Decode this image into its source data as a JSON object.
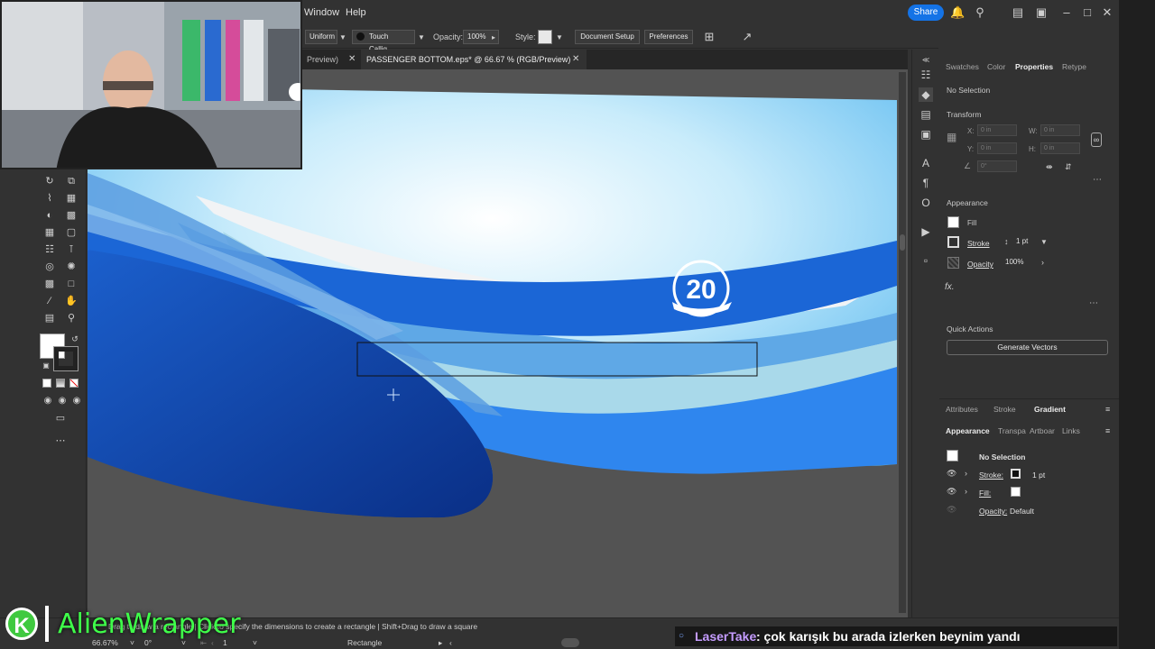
{
  "menu": {
    "window": "Window",
    "help": "Help",
    "share": "Share"
  },
  "control_bar": {
    "profile": "Uniform",
    "brush": "Touch Callig...",
    "opacity_label": "Opacity:",
    "opacity_value": "100%",
    "style_label": "Style:",
    "document_setup": "Document Setup",
    "preferences": "Preferences"
  },
  "tabs": [
    {
      "label": "Preview)"
    },
    {
      "label": "PASSENGER BOTTOM.eps* @ 66.67 % (RGB/Preview)"
    }
  ],
  "artwork": {
    "badge_number": "20"
  },
  "properties": {
    "tabs": [
      "Swatches",
      "Color",
      "Properties",
      "Retype"
    ],
    "active_tab": "Properties",
    "selection": "No Selection",
    "transform_title": "Transform",
    "x_label": "X:",
    "y_label": "Y:",
    "w_label": "W:",
    "h_label": "H:",
    "x_value": "0 in",
    "y_value": "0 in",
    "w_value": "0 in",
    "h_value": "0 in",
    "angle_value": "0°",
    "appearance_title": "Appearance",
    "fill_label": "Fill",
    "stroke_label": "Stroke",
    "stroke_weight": "1 pt",
    "opacity_label": "Opacity",
    "opacity_value": "100%",
    "fx_label": "fx.",
    "quick_actions_title": "Quick Actions",
    "generate_vectors": "Generate Vectors"
  },
  "lower_panel": {
    "tabs_row1": [
      "Attributes",
      "Stroke",
      "Gradient"
    ],
    "tabs_row2": [
      "Appearance",
      "Transpa",
      "Artboar",
      "Links"
    ],
    "selection": "No Selection",
    "stroke_label": "Stroke:",
    "stroke_value": "1 pt",
    "fill_label": "Fill:",
    "opacity_label": "Opacity:",
    "opacity_value": "Default"
  },
  "status": {
    "hint": "Drag to draw a rectangle | Click to specify the dimensions to create a rectangle  |  Shift+Drag to draw a square",
    "zoom": "66.67%",
    "rotation": "0°",
    "artboard": "1",
    "tool": "Rectangle"
  },
  "overlay": {
    "brand_letter": "K",
    "brand_name": "AlienWrapper",
    "chat_user": "LaserTake",
    "chat_message": ": çok karışık bu arada izlerken beynim yandı"
  },
  "colors": {
    "accent": "#1473e6",
    "sky_top": "#6fc6f5",
    "wave_dark": "#0f3d9e",
    "wave_mid": "#1b66d6",
    "wave_light": "#5fa8e6",
    "wave_pale": "#a9d9ea",
    "brand_green": "#3fff4a"
  }
}
